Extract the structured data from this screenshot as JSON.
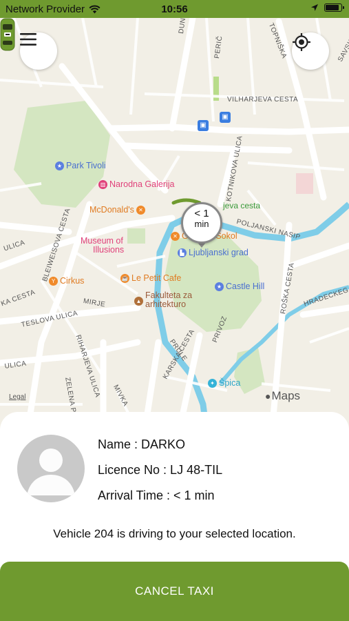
{
  "status_bar": {
    "carrier": "Network Provider",
    "time": "10:56",
    "battery_level": 0.9
  },
  "map": {
    "attribution_legal": "Legal",
    "attribution_maps": "Maps",
    "streets": [
      "DUNAJSKA",
      "TOPNIŠKA",
      "VILHARJEVA CESTA",
      "KOTNIKOVA ULICA",
      "BLEIWEISOVA CESTA",
      "POLJANSKI NASIP",
      "ROŠKA CESTA",
      "HRADECKEGA CE",
      "TESLOVA ULICA",
      "RIHARJEVA ULICA",
      "PRULE",
      "PRIVOZ",
      "MIRJE",
      "ZELENA POT",
      "MIVKA",
      "KARSKA CESTA",
      "SAVSK",
      "ULICA",
      "ULICA",
      "KA CESTA",
      "PERIČ"
    ],
    "pois": {
      "park_tivoli": "Park Tivoli",
      "narodna_galerija": "Narodna Galerija",
      "mcdonalds": "McDonald's",
      "museum_of_illusions_1": "Museum of",
      "museum_of_illusions_2": "Illusions",
      "cirkus": "Cirkus",
      "le_petit_cafe": "Le Petit Cafe",
      "fakulteta_1": "Fakulteta za",
      "fakulteta_2": "arhitekturo",
      "gostilna_sokol": "Gostilna Sokol",
      "ljubljanski_grad": "Ljubljanski grad",
      "castle_hill": "Castle Hill",
      "spica": "Špica",
      "jeva_cesta": "jeva cesta"
    },
    "eta_pin": {
      "line1": "< 1",
      "line2": "min"
    },
    "icons": {
      "menu": "hamburger-menu-icon",
      "locate": "crosshair-location-icon"
    }
  },
  "driver": {
    "name_line": "Name : DARKO",
    "licence_line": "Licence No : LJ 48-TIL",
    "arrival_line": "Arrival Time : < 1 min",
    "description": "Vehicle 204 is driving to your selected location."
  },
  "actions": {
    "cancel_label": "CANCEL TAXI"
  },
  "colors": {
    "brand_green": "#6f9a2f",
    "water": "#7fcde8",
    "park": "#d4e6c1"
  }
}
